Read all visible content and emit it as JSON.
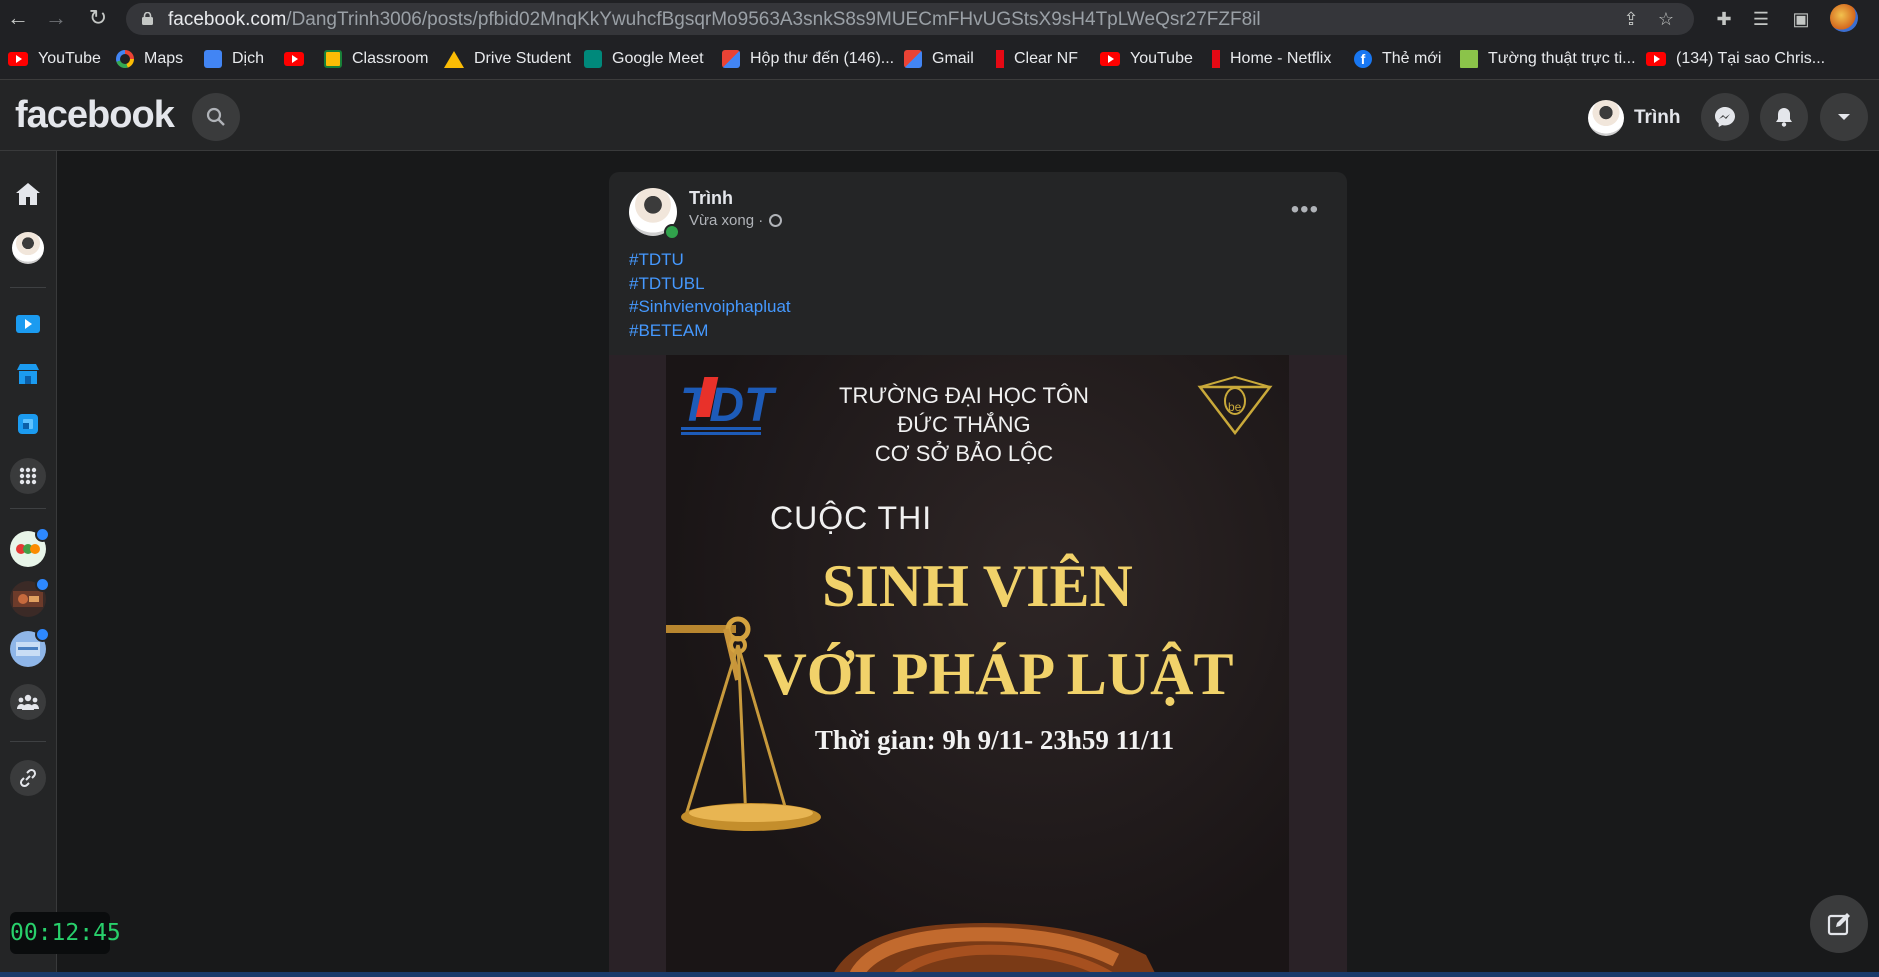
{
  "browser": {
    "url_host": "facebook.com",
    "url_path": "/DangTrinh3006/posts/pfbid02MnqKkYwuhcfBgsqrMo9563A3snkS8s9MUECmFHvUGStsX9sH4TpLWeQsr27FZF8il",
    "bookmarks": [
      {
        "label": "YouTube",
        "icon": "youtube-icon"
      },
      {
        "label": "Maps",
        "icon": "google-icon"
      },
      {
        "label": "Dịch",
        "icon": "translate-icon"
      },
      {
        "label": "",
        "icon": "youtube-icon"
      },
      {
        "label": "Classroom",
        "icon": "classroom-icon"
      },
      {
        "label": "Drive Student",
        "icon": "drive-icon"
      },
      {
        "label": "Google Meet",
        "icon": "meet-icon"
      },
      {
        "label": "Hộp thư đến (146)...",
        "icon": "gmail-icon"
      },
      {
        "label": "Gmail",
        "icon": "gmail-icon"
      },
      {
        "label": "Clear NF",
        "icon": "netflix-icon"
      },
      {
        "label": "YouTube",
        "icon": "youtube-icon"
      },
      {
        "label": "Home - Netflix",
        "icon": "netflix-icon"
      },
      {
        "label": "Thẻ mới",
        "icon": "facebook-icon"
      },
      {
        "label": "Tường thuật trực ti...",
        "icon": "site-icon"
      },
      {
        "label": "(134) Tại sao Chris...",
        "icon": "youtube-icon"
      }
    ]
  },
  "facebook": {
    "logo": "facebook",
    "user_name": "Trình"
  },
  "post": {
    "author": "Trình",
    "time": "Vừa xong ·",
    "hashtags": [
      "#TDTU",
      "#TDTUBL",
      "#Sinhvienvoiphapluat",
      "#BETEAM"
    ],
    "poster": {
      "logo_text": "TDT",
      "school_line1": "TRƯỜNG ĐẠI HỌC TÔN ĐỨC THẮNG",
      "school_line2": "CƠ SỞ BẢO LỘC",
      "contest_label": "CUỘC THI",
      "title_line1": "SINH VIÊN",
      "title_line2": "VỚI PHÁP LUẬT",
      "time_line": "Thời gian: 9h 9/11- 23h59 11/11",
      "badge_text": "be"
    }
  },
  "timer": "00:12:45",
  "colors": {
    "fb_bg": "#18191a",
    "fb_surface": "#242526",
    "link_blue": "#4599ff",
    "poster_gold": "#f1d26a",
    "online_green": "#31a24c"
  }
}
